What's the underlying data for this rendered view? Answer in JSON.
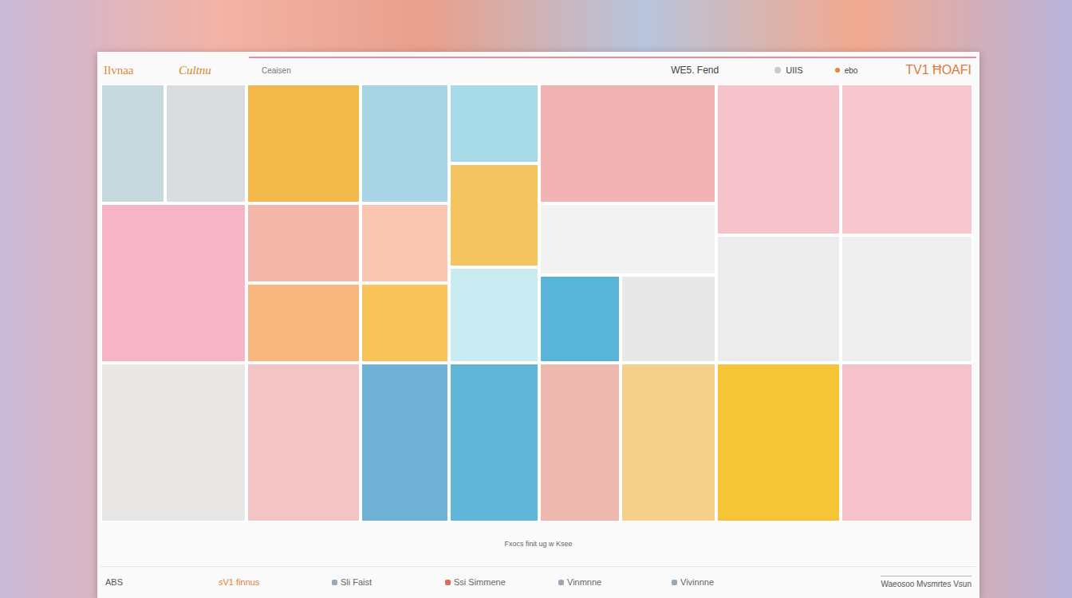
{
  "header": {
    "logo": "Ilvnaa",
    "brand": "Cultnu",
    "tagline": "Ceaisen",
    "links": [
      {
        "label": "WE5. Fend"
      },
      {
        "label": "UIIS"
      },
      {
        "label": "ebo"
      }
    ],
    "cart": "TV1 ĦOAFI"
  },
  "tiles": [
    {
      "color": "#c6d9df"
    },
    {
      "color": "#d9dde0"
    },
    {
      "color": "#f2b84a"
    },
    {
      "color": "#a9d4e6"
    },
    {
      "color": "#a7dbe8"
    },
    {
      "color": "#f4c460"
    },
    {
      "color": "#f2b3b5"
    },
    {
      "color": "#f6c3cd"
    },
    {
      "color": "#f7c7cf"
    },
    {
      "color": "#f7b6c8"
    },
    {
      "color": "#f5b8a8"
    },
    {
      "color": "#f7b77f"
    },
    {
      "color": "#f9c7b0"
    },
    {
      "color": "#f7c35a"
    },
    {
      "color": "#c8ecf2"
    },
    {
      "color": "#f2f2f2"
    },
    {
      "color": "#5ab6d8"
    },
    {
      "color": "#e8e8e8"
    },
    {
      "color": "#ececec"
    },
    {
      "color": "#efefef"
    },
    {
      "color": "#e9e6e6"
    },
    {
      "color": "#f3c4c4"
    },
    {
      "color": "#6fb2d6"
    },
    {
      "color": "#5fb6d9"
    },
    {
      "color": "#f0b9b0"
    },
    {
      "color": "#f4d08a"
    },
    {
      "color": "#f6c537"
    },
    {
      "color": "#f5c2cb"
    }
  ],
  "caption": "Fxocs finit ug w Ksee",
  "footer": {
    "items": [
      "ABS",
      "sV1 finnus",
      "Sli Faist",
      "Ssi Simmene",
      "Vinmnne",
      "Vivinnne"
    ],
    "note": "Waeosoo Mvsmrtes Vsun"
  }
}
